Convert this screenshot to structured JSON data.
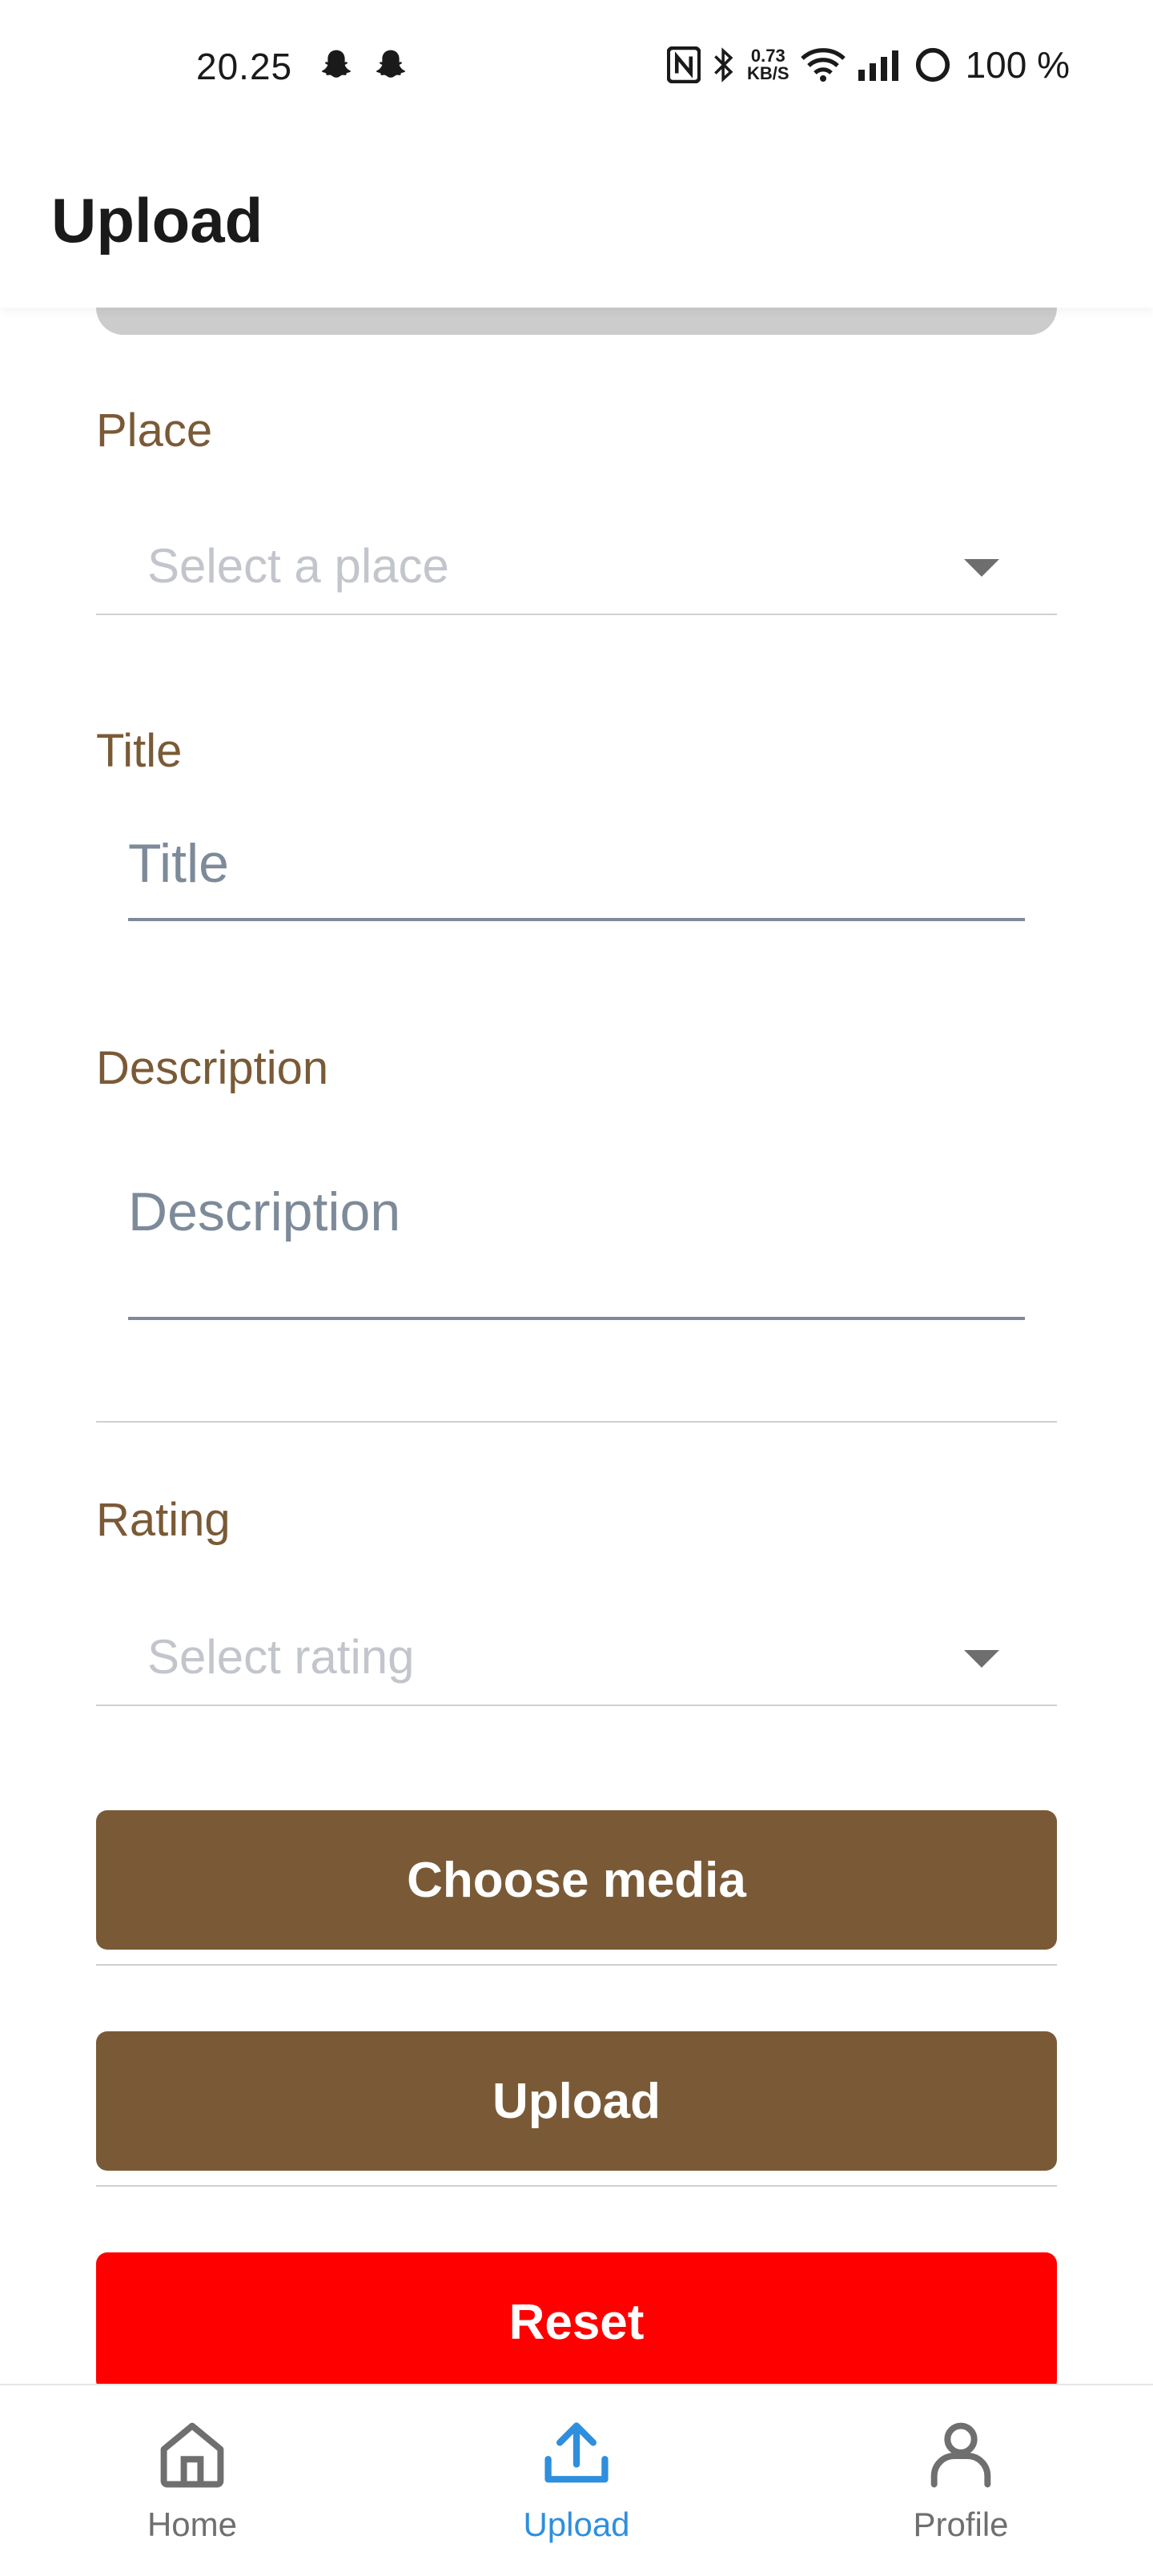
{
  "status_bar": {
    "time": "20.25",
    "net_speed_value": "0.73",
    "net_speed_unit": "KB/S",
    "battery": "100 %",
    "icons": [
      "snapchat-icon",
      "snapchat-icon",
      "nfc-icon",
      "bluetooth-icon",
      "wifi-icon",
      "signal-icon",
      "battery-icon"
    ]
  },
  "header": {
    "title": "Upload"
  },
  "form": {
    "place": {
      "label": "Place",
      "placeholder": "Select a place"
    },
    "title": {
      "label": "Title",
      "placeholder": "Title",
      "value": ""
    },
    "description": {
      "label": "Description",
      "placeholder": "Description",
      "value": ""
    },
    "rating": {
      "label": "Rating",
      "placeholder": "Select rating"
    },
    "buttons": {
      "choose_media": "Choose media",
      "upload": "Upload",
      "reset": "Reset"
    }
  },
  "colors": {
    "accent_brown": "#7a5a36",
    "reset_red": "#ff0000",
    "nav_active": "#2f8fdc",
    "nav_inactive": "#6f6f6f"
  },
  "bottom_nav": {
    "items": [
      {
        "label": "Home",
        "icon": "home-icon",
        "active": false
      },
      {
        "label": "Upload",
        "icon": "upload-icon",
        "active": true
      },
      {
        "label": "Profile",
        "icon": "profile-icon",
        "active": false
      }
    ]
  }
}
